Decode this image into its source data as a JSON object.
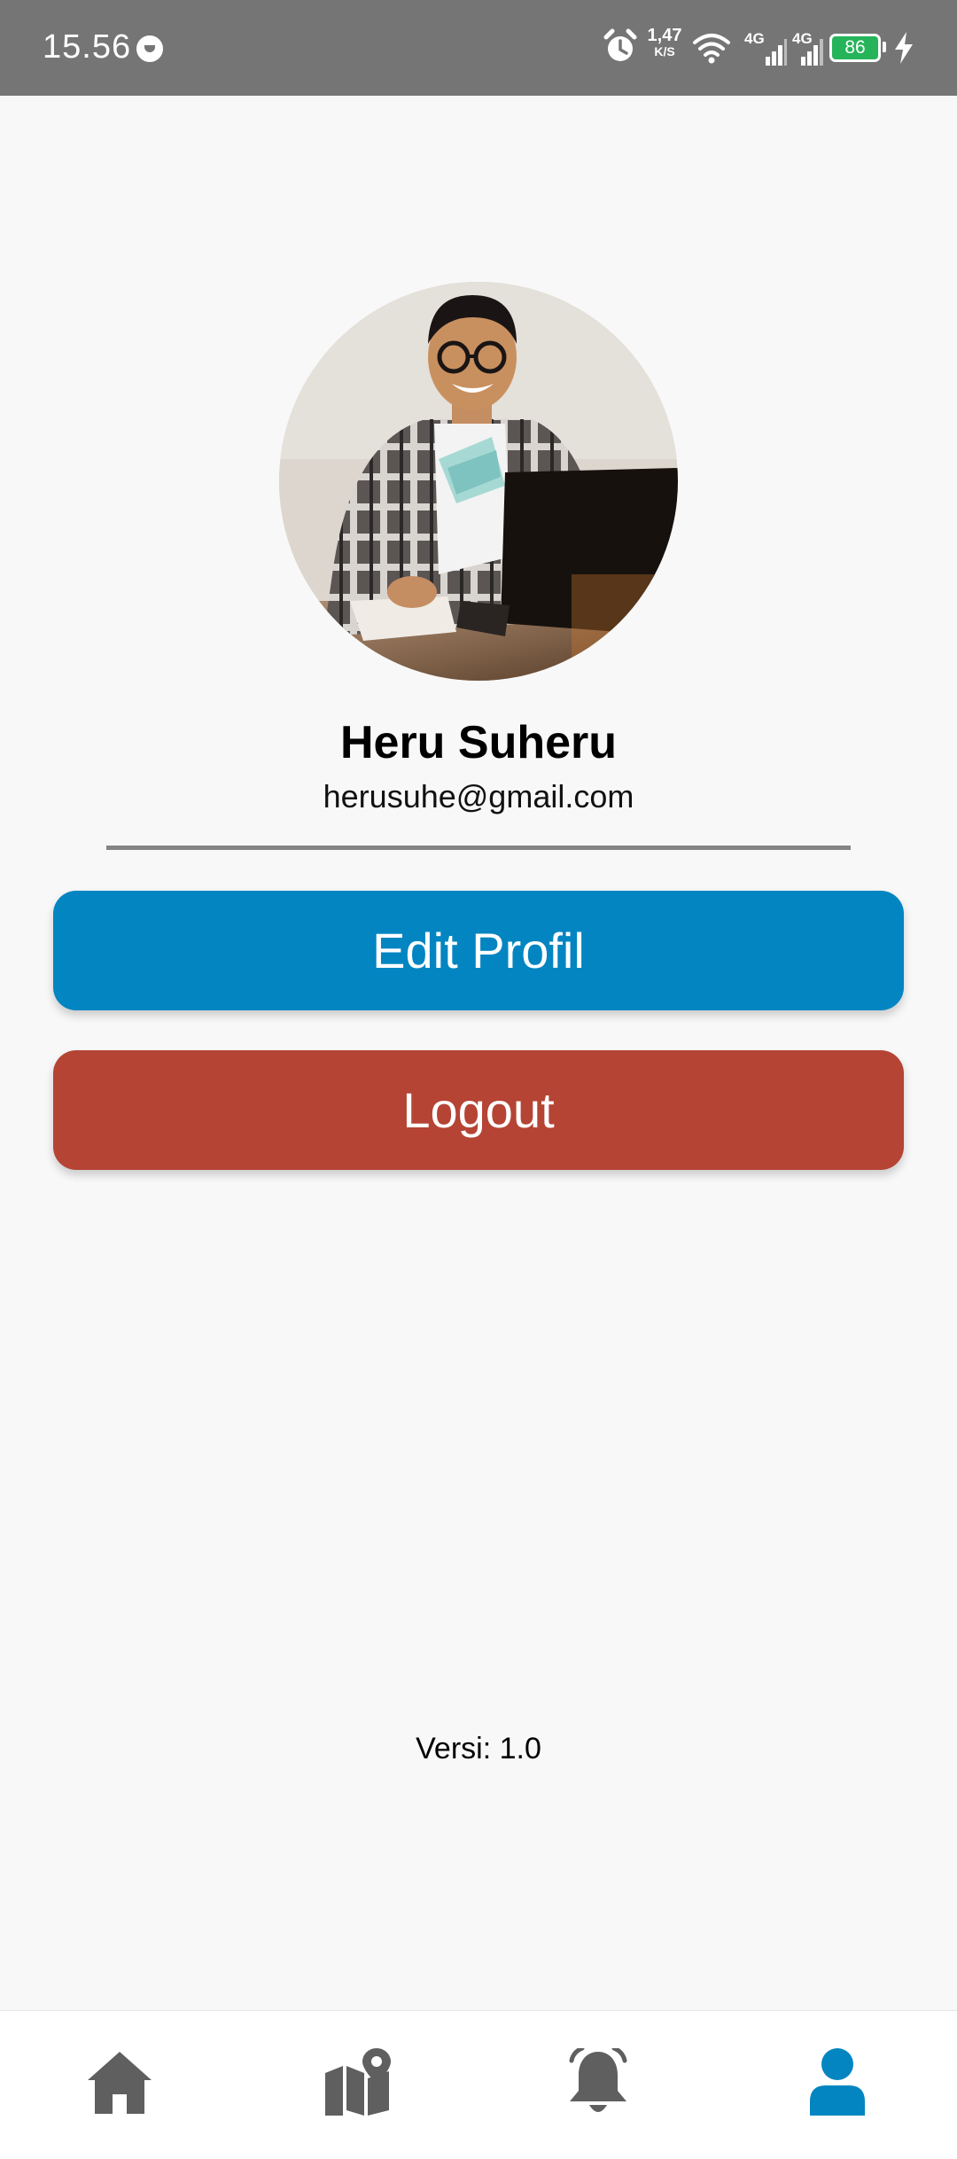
{
  "status_bar": {
    "time": "15.56",
    "speed_value": "1,47",
    "speed_unit": "K/S",
    "network_1": "4G",
    "network_2": "4G",
    "battery_level": "86"
  },
  "profile": {
    "name": "Heru Suheru",
    "email": "herusuhe@gmail.com"
  },
  "buttons": {
    "edit_label": "Edit Profil",
    "logout_label": "Logout"
  },
  "footer": {
    "version": "Versi: 1.0"
  },
  "bottom_nav": {
    "items": [
      {
        "icon": "home-icon",
        "active": false
      },
      {
        "icon": "map-icon",
        "active": false
      },
      {
        "icon": "bell-icon",
        "active": false
      },
      {
        "icon": "user-icon",
        "active": true
      }
    ]
  },
  "colors": {
    "primary": "#0385c1",
    "danger": "#b54434",
    "nav_inactive": "#5f5f5f",
    "nav_active": "#0385c1",
    "battery": "#25b45a"
  }
}
